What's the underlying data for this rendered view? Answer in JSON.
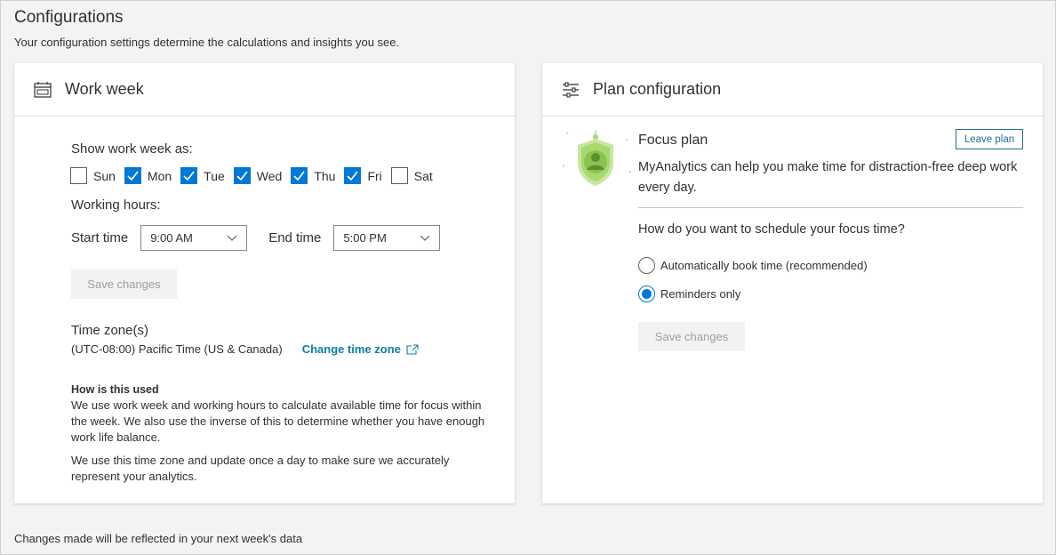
{
  "page": {
    "title": "Configurations",
    "subtitle": "Your configuration settings determine the calculations and insights you see.",
    "footer": "Changes made will be reflected in your next week's data"
  },
  "work_week": {
    "title": "Work week",
    "icon": "calendar-icon",
    "show_label": "Show work week as:",
    "days": [
      {
        "label": "Sun",
        "checked": false
      },
      {
        "label": "Mon",
        "checked": true
      },
      {
        "label": "Tue",
        "checked": true
      },
      {
        "label": "Wed",
        "checked": true
      },
      {
        "label": "Thu",
        "checked": true
      },
      {
        "label": "Fri",
        "checked": true
      },
      {
        "label": "Sat",
        "checked": false
      }
    ],
    "hours_label": "Working hours:",
    "start_label": "Start time",
    "start_value": "9:00 AM",
    "end_label": "End time",
    "end_value": "5:00 PM",
    "save_label": "Save changes",
    "timezone_label": "Time zone(s)",
    "timezone_value": "(UTC-08:00) Pacific Time (US & Canada)",
    "change_timezone": "Change time zone",
    "how_title": "How is this used",
    "how_p1": "We use work week and working hours to calculate available time for focus within the week. We also use the inverse of this to determine whether you have enough work life balance.",
    "how_p2": "We use this time zone and update once a day to make sure we accurately represent your analytics."
  },
  "plan": {
    "title": "Plan configuration",
    "icon": "sliders-icon",
    "focus_title": "Focus plan",
    "leave_label": "Leave plan",
    "focus_desc": "MyAnalytics can help you make time for distraction-free deep work every day.",
    "question": "How do you want to schedule your focus time?",
    "options": [
      {
        "label": "Automatically book time (recommended)",
        "selected": false
      },
      {
        "label": "Reminders only",
        "selected": true
      }
    ],
    "save_label": "Save changes"
  },
  "colors": {
    "accent": "#0078d4",
    "link": "#0a7ea4",
    "illustration": "#a8d86e"
  }
}
